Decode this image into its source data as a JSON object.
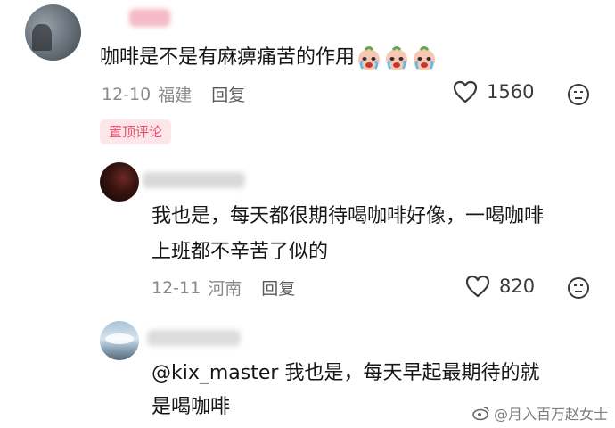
{
  "main_comment": {
    "text": "咖啡是不是有麻痹痛苦的作用",
    "emojis": [
      "crying-face-icon",
      "crying-face-icon",
      "crying-face-icon"
    ],
    "date": "12-10",
    "location": "福建",
    "reply_label": "回复",
    "likes": "1560",
    "pinned_label": "置顶评论"
  },
  "reply1": {
    "line1": "我也是，每天都很期待喝咖啡好像，一喝咖啡",
    "line2": "上班都不辛苦了似的",
    "date": "12-11",
    "location": "河南",
    "reply_label": "回复",
    "likes": "820"
  },
  "reply2": {
    "line1": "@kix_master 我也是，每天早起最期待的就",
    "line2": "是喝咖啡"
  },
  "watermark": "@月入百万赵女士",
  "colors": {
    "pinned_bg": "#fde6ea",
    "pinned_text": "#e9506b",
    "meta_gray": "#8a8a8a"
  }
}
